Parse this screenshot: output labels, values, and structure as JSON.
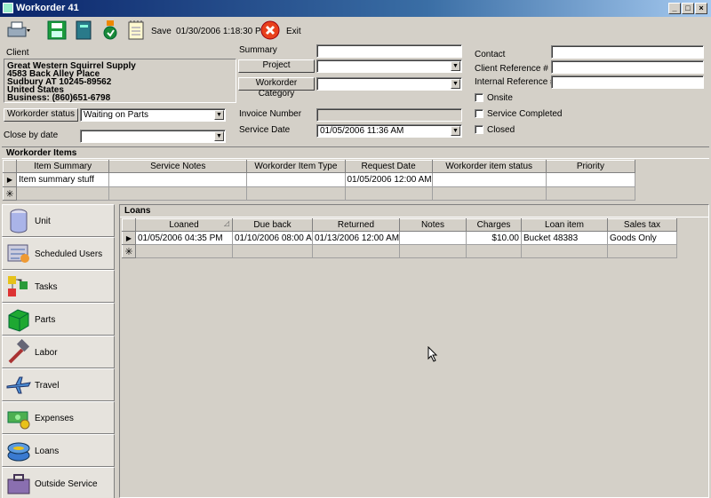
{
  "window": {
    "title": "Workorder 41",
    "controls": [
      "_",
      "□",
      "×"
    ]
  },
  "toolbar": {
    "save_label": "Save",
    "timestamp": "01/30/2006 1:18:30 PM",
    "exit_label": "Exit"
  },
  "client": {
    "label": "Client",
    "lines": [
      "Great Western Squirrel Supply",
      "4583 Back Alley Place",
      "Sudbury AT  10245-89562",
      "United States",
      "Business: (860)651-6798"
    ]
  },
  "workorder_status": {
    "button": "Workorder status",
    "value": "Waiting on Parts"
  },
  "close_by_date": {
    "label": "Close by date",
    "value": ""
  },
  "summary": {
    "label": "Summary",
    "value": ""
  },
  "project": {
    "button": "Project",
    "value": ""
  },
  "workorder_category": {
    "button": "Workorder Category",
    "value": ""
  },
  "invoice_number": {
    "label": "Invoice Number",
    "value": ""
  },
  "service_date": {
    "label": "Service Date",
    "value": "01/05/2006 11:36 AM"
  },
  "contact": {
    "label": "Contact",
    "value": ""
  },
  "client_reference": {
    "label": "Client Reference #",
    "value": ""
  },
  "internal_reference": {
    "label": "Internal Reference #",
    "value": ""
  },
  "checkboxes": {
    "onsite": "Onsite",
    "service_completed": "Service Completed",
    "closed": "Closed"
  },
  "workorder_items": {
    "title": "Workorder Items",
    "columns": [
      "Item Summary",
      "Service Notes",
      "Workorder Item Type",
      "Request Date",
      "Workorder item status",
      "Priority"
    ],
    "rows": [
      [
        "Item summary stuff",
        "",
        "",
        "01/05/2006 12:00 AM",
        "",
        ""
      ]
    ],
    "row_marker": "▶",
    "new_marker": "✳"
  },
  "nav": {
    "items": [
      {
        "label": "Unit",
        "icon": "unit-icon"
      },
      {
        "label": "Scheduled Users",
        "icon": "scheduled-users-icon"
      },
      {
        "label": "Tasks",
        "icon": "tasks-icon"
      },
      {
        "label": "Parts",
        "icon": "parts-icon"
      },
      {
        "label": "Labor",
        "icon": "labor-icon"
      },
      {
        "label": "Travel",
        "icon": "travel-icon"
      },
      {
        "label": "Expenses",
        "icon": "expenses-icon"
      },
      {
        "label": "Loans",
        "icon": "loans-icon"
      },
      {
        "label": "Outside Service",
        "icon": "outside-service-icon"
      }
    ]
  },
  "loans": {
    "title": "Loans",
    "columns": [
      "Loaned",
      "Due back",
      "Returned",
      "Notes",
      "Charges",
      "Loan item",
      "Sales tax"
    ],
    "rows": [
      [
        "01/05/2006 04:35 PM",
        "01/10/2006 08:00 AM",
        "01/13/2006 12:00 AM",
        "",
        "$10.00",
        "Bucket 48383",
        "Goods Only"
      ]
    ],
    "row_marker": "▶",
    "new_marker": "✳",
    "sort_glyph": "◿"
  },
  "colors": {
    "titlebar_start": "#0a246a",
    "titlebar_end": "#a6caf0",
    "face": "#d4d0c8"
  }
}
